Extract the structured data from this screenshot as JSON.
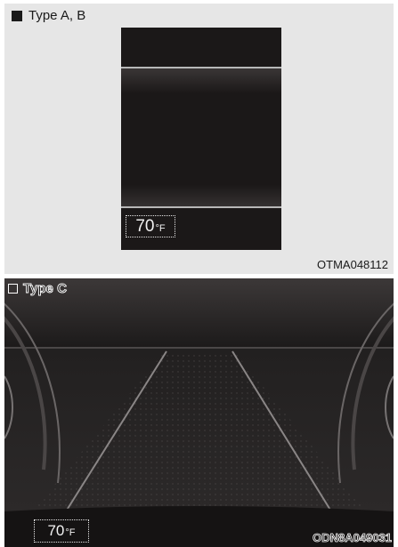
{
  "panel_a": {
    "caption": "Type A, B",
    "temperature_value": "70",
    "temperature_unit": "°F",
    "figure_code": "OTMA048112"
  },
  "panel_c": {
    "caption": "Type C",
    "temperature_value": "70",
    "temperature_unit": "°F",
    "figure_code": "ODN8A049031"
  },
  "colors": {
    "panel_a_bg": "#e6e6e6",
    "screen_bg": "#1b1818",
    "text_light": "#f2f2f2"
  }
}
